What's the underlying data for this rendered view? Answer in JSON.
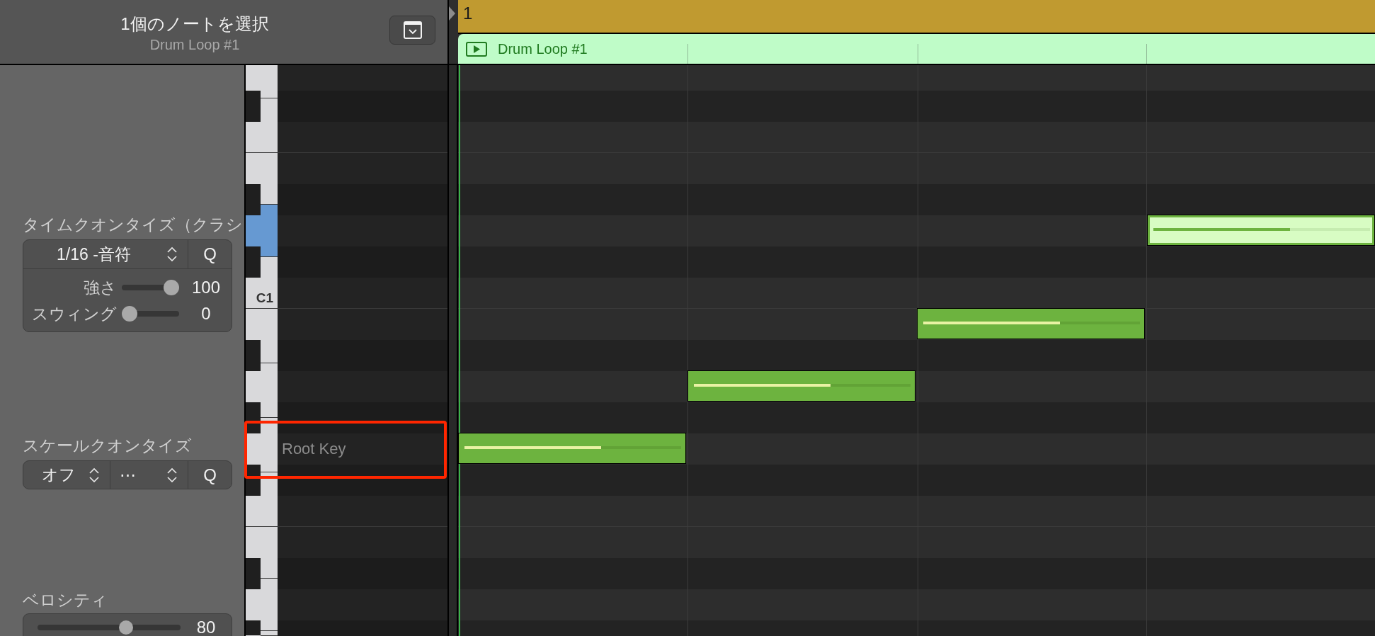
{
  "header": {
    "title": "1個のノートを選択",
    "subtitle": "Drum Loop #1"
  },
  "inspector": {
    "time_quantize": {
      "label": "タイムクオンタイズ（クラシ",
      "value": "1/16 -音符",
      "button": "Q",
      "sliders": [
        {
          "label": "強さ",
          "level": 1,
          "reading": "100"
        },
        {
          "label": "スウィング",
          "level": 0,
          "reading": "0"
        }
      ]
    },
    "scale_quantize": {
      "label": "スケールクオンタイズ",
      "mode": "オフ",
      "scale": "⋯",
      "button": "Q"
    },
    "velocity": {
      "label": "ベロシティ",
      "level": 0.63,
      "reading": "80"
    }
  },
  "ruler": {
    "bar": "1"
  },
  "region": {
    "name": "Drum Loop #1"
  },
  "keyboard": {
    "keys": [
      {
        "kind": "white",
        "selected": false
      },
      {
        "kind": "black",
        "selected": false
      },
      {
        "kind": "white",
        "selected": false
      },
      {
        "kind": "white",
        "selected": false
      },
      {
        "kind": "black",
        "selected": false
      },
      {
        "kind": "white",
        "selected": true
      },
      {
        "kind": "black",
        "selected": false
      },
      {
        "kind": "white",
        "selected": false,
        "label": "C1"
      },
      {
        "kind": "white",
        "selected": false
      },
      {
        "kind": "black",
        "selected": false
      },
      {
        "kind": "white",
        "selected": false
      },
      {
        "kind": "black",
        "selected": false
      },
      {
        "kind": "white",
        "selected": false
      },
      {
        "kind": "black",
        "selected": false
      },
      {
        "kind": "white",
        "selected": false
      },
      {
        "kind": "white",
        "selected": false
      },
      {
        "kind": "black",
        "selected": false
      },
      {
        "kind": "white",
        "selected": false
      },
      {
        "kind": "black",
        "selected": false
      },
      {
        "kind": "white",
        "selected": false
      }
    ]
  },
  "piano_roll": {
    "lanes": [
      {
        "kind": "white"
      },
      {
        "kind": "black"
      },
      {
        "kind": "white"
      },
      {
        "kind": "white"
      },
      {
        "kind": "black"
      },
      {
        "kind": "white"
      },
      {
        "kind": "black"
      },
      {
        "kind": "white"
      },
      {
        "kind": "white"
      },
      {
        "kind": "black"
      },
      {
        "kind": "white"
      },
      {
        "kind": "black"
      },
      {
        "kind": "white",
        "label": "Root Key"
      },
      {
        "kind": "black"
      },
      {
        "kind": "white"
      },
      {
        "kind": "white"
      },
      {
        "kind": "black"
      },
      {
        "kind": "white"
      },
      {
        "kind": "black"
      }
    ],
    "notes": [
      {
        "selected": false,
        "level": 0.63
      },
      {
        "selected": false,
        "level": 0.63
      },
      {
        "selected": false,
        "level": 0.63
      },
      {
        "selected": true,
        "level": 0.63
      }
    ]
  }
}
